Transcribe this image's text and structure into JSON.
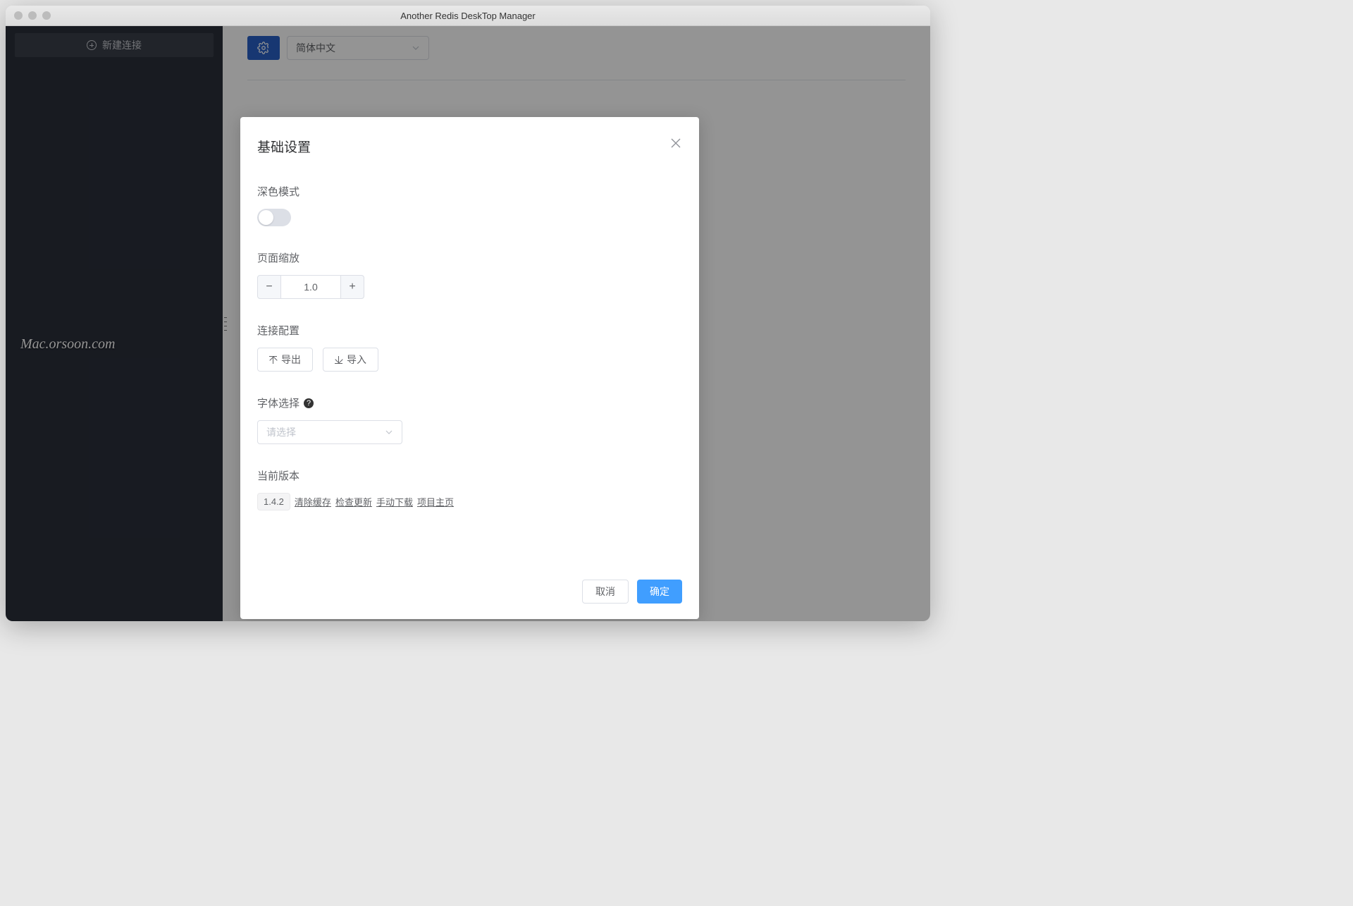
{
  "window": {
    "title": "Another Redis DeskTop Manager"
  },
  "sidebar": {
    "new_connection": "新建连接"
  },
  "toolbar": {
    "language_value": "简体中文"
  },
  "watermark": "Mac.orsoon.com",
  "dialog": {
    "title": "基础设置",
    "dark_mode_label": "深色模式",
    "dark_mode_on": false,
    "zoom_label": "页面缩放",
    "zoom_value": "1.0",
    "conn_config_label": "连接配置",
    "export_label": "导出",
    "import_label": "导入",
    "font_label": "字体选择",
    "font_placeholder": "请选择",
    "version_label": "当前版本",
    "version_value": "1.4.2",
    "links": {
      "clear_cache": "清除缓存",
      "check_update": "检查更新",
      "manual_download": "手动下载",
      "project_home": "项目主页"
    },
    "cancel": "取消",
    "ok": "确定"
  }
}
